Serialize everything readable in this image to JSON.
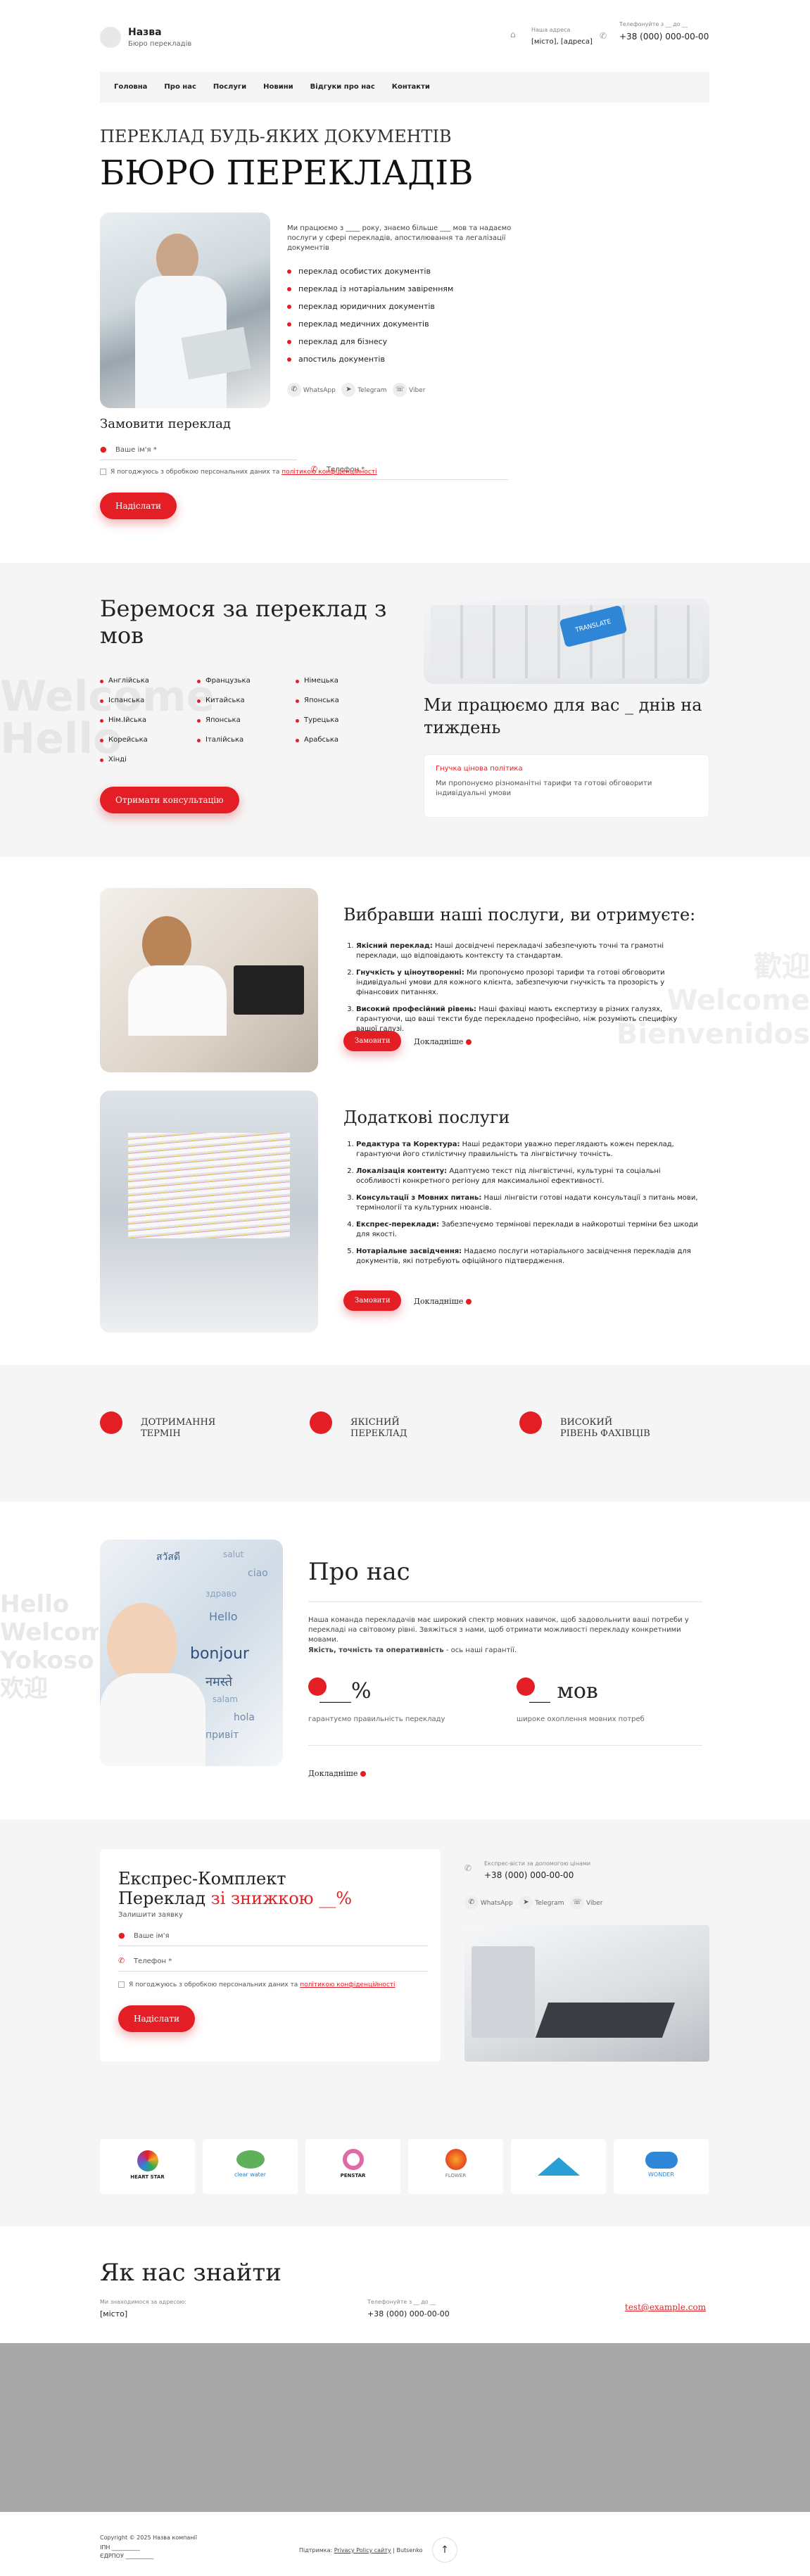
{
  "header": {
    "logo_title": "Назва",
    "logo_sub": "Бюро перекладів",
    "address_label": "Наша адреса",
    "address_value": "[місто], [адреса]",
    "phone_label": "Телефонуйте з __ до __",
    "phone_value": "+38 (000) 000-00-00"
  },
  "nav": [
    "Головна",
    "Про нас",
    "Послуги",
    "Новини",
    "Відгуки про нас",
    "Контакти"
  ],
  "hero": {
    "subtitle": "ПЕРЕКЛАД БУДЬ-ЯКИХ ДОКУМЕНТІВ",
    "title": "БЮРО ПЕРЕКЛАДІВ",
    "intro": "Ми працюємо з ____ року, знаємо більше ___ мов та надаємо послуги у сфері перекладів, апостилювання та легалізації документів",
    "items": [
      "переклад особистих документів",
      "переклад із нотаріальним завіренням",
      "переклад юридичних документів",
      "переклад медичних документів",
      "переклад для бізнесу",
      "апостиль документів"
    ],
    "messengers": [
      "WhatsApp",
      "Telegram",
      "Viber"
    ]
  },
  "order_form": {
    "title": "Замовити переклад",
    "name": "Ваше ім'я *",
    "phone": "Телефон *",
    "consent": "Я погоджуюсь з обробкою персональних даних та ",
    "policy": "політикою конфіденційності",
    "submit": "Надіслати"
  },
  "languages": {
    "title": "Беремося за переклад з мов",
    "col1": [
      "Англійська",
      "Іспанська",
      "Нім.Ійська",
      "Корейська",
      "Хінді"
    ],
    "col2": [
      "Французька",
      "Китайська",
      "Японська",
      "Італійська"
    ],
    "col3": [
      "Німецька",
      "Японська",
      "Турецька",
      "Арабська"
    ],
    "button": "Отримати консультацію",
    "days_title": "Ми працюємо для вас _ днів на тиждень",
    "policy_title": "Гнучка цінова політика",
    "policy_text": "Ми пропонуємо різноманітні тарифи та готові обговорити індивідуальні умови",
    "keyboard_key": "TRANSLATE"
  },
  "benefits": {
    "title": "Вибравши наші послуги, ви отримуєте:",
    "items": [
      {
        "bold": "Якісний переклад:",
        "text": " Наші досвідчені перекладачі забезпечують точні та грамотні переклади, що відповідають контексту та стандартам."
      },
      {
        "bold": "Гнучкість у ціноутворенні:",
        "text": " Ми пропонуємо прозорі тарифи та готові обговорити індивідуальні умови для кожного клієнта, забезпечуючи гнучкість та прозорість у фінансових питаннях."
      },
      {
        "bold": "Високий професійний рівень:",
        "text": " Наші фахівці мають експертизу в різних галузях, гарантуючи, що ваші тексти буде перекладено професійно, ніж розуміють специфіку вашої галузі."
      }
    ],
    "order": "Замовити",
    "more": "Докладніше"
  },
  "extra": {
    "title": "Додаткові послуги",
    "items": [
      {
        "bold": "Редактура та Коректура:",
        "text": " Наші редактори уважно переглядають кожен переклад, гарантуючи його стилістичну правильність та лінгвістичну точність."
      },
      {
        "bold": "Локалізація контенту:",
        "text": " Адаптуємо текст під лінгвістичні, культурні та соціальні особливості конкретного регіону для максимальної ефективності."
      },
      {
        "bold": "Консультації з Мовних питань:",
        "text": " Наші лінгвісти готові надати консультації з питань мови, термінології та культурних нюансів."
      },
      {
        "bold": "Експрес-переклади:",
        "text": " Забезпечуємо терміновi переклади в найкоротші терміни без шкоди для якості."
      },
      {
        "bold": "Нотаріальне засвідчення:",
        "text": " Надаємо послуги нотаріального засвідчення перекладів для документів, які потребують офіційного підтвердження."
      }
    ],
    "order": "Замовити",
    "more": "Докладніше"
  },
  "features": [
    {
      "l1": "ДОТРИМАННЯ",
      "l2": "ТЕРМІН"
    },
    {
      "l1": "ЯКІСНИЙ",
      "l2": "ПЕРЕКЛАД"
    },
    {
      "l1": "ВИСОКИЙ",
      "l2": "РІВЕНЬ ФАХІВЦІВ"
    }
  ],
  "about": {
    "title": "Про нас",
    "p1": "Наша команда перекладачів має широкий спектр мовних навичок, щоб задовольнити ваші потреби у перекладі на світовому рівні. Звяжіться з нами, щоб отримати можливості перекладу конкретними мовами.",
    "p2_bold": "Якість, точність та оперативність",
    "p2": " - ось наші гарантії.",
    "stat1_value": "___%",
    "stat1_label": "гарантуємо правильність перекладу",
    "stat2_value": "__ мов",
    "stat2_label": "широке охоплення мовних потреб",
    "more": "Докладніше",
    "words": [
      "bonjour",
      "Hello",
      "ciao",
      "здраво",
      "salam",
      "नमस्ते",
      "привіт",
      "hola",
      "สวัสดี",
      "salut"
    ]
  },
  "express": {
    "title1": "Експрес-Комплект",
    "title2": "Переклад ",
    "title_red": "зі знижкою __%",
    "sub": "Залишити заявку",
    "name": "Ваше ім'я",
    "phone": "Телефон *",
    "consent": "Я погоджуюсь з обробкою персональних даних та ",
    "policy": "політикою конфіденційності",
    "submit": "Надіслати",
    "contact_label": "Експрес-вісти за допомогою цінами",
    "contact_phone": "+38 (000) 000-00-00",
    "messengers": [
      "WhatsApp",
      "Telegram",
      "Viber"
    ]
  },
  "logos": [
    "HEART STAR",
    "clear water",
    "PENSTAR",
    "FLOWER",
    "",
    "WONDER"
  ],
  "find": {
    "title": "Як нас знайти",
    "addr_label": "Ми знаходимося за адресою:",
    "addr_value": "[місто]",
    "phone_label": "Телефонуйте з __ до __",
    "phone_value": "+38 (000) 000-00-00",
    "email": "test@example.com"
  },
  "footer": {
    "copyright": "Copyright © 2025 Назва компанії",
    "inn": "ІПН __________",
    "edrpou": "ЄДРПОУ __________",
    "support": "Підтримка: ",
    "policy": "Privacy Policy сайту",
    "by": " | Butsenko"
  },
  "colors": {
    "accent": "#e31e24"
  }
}
